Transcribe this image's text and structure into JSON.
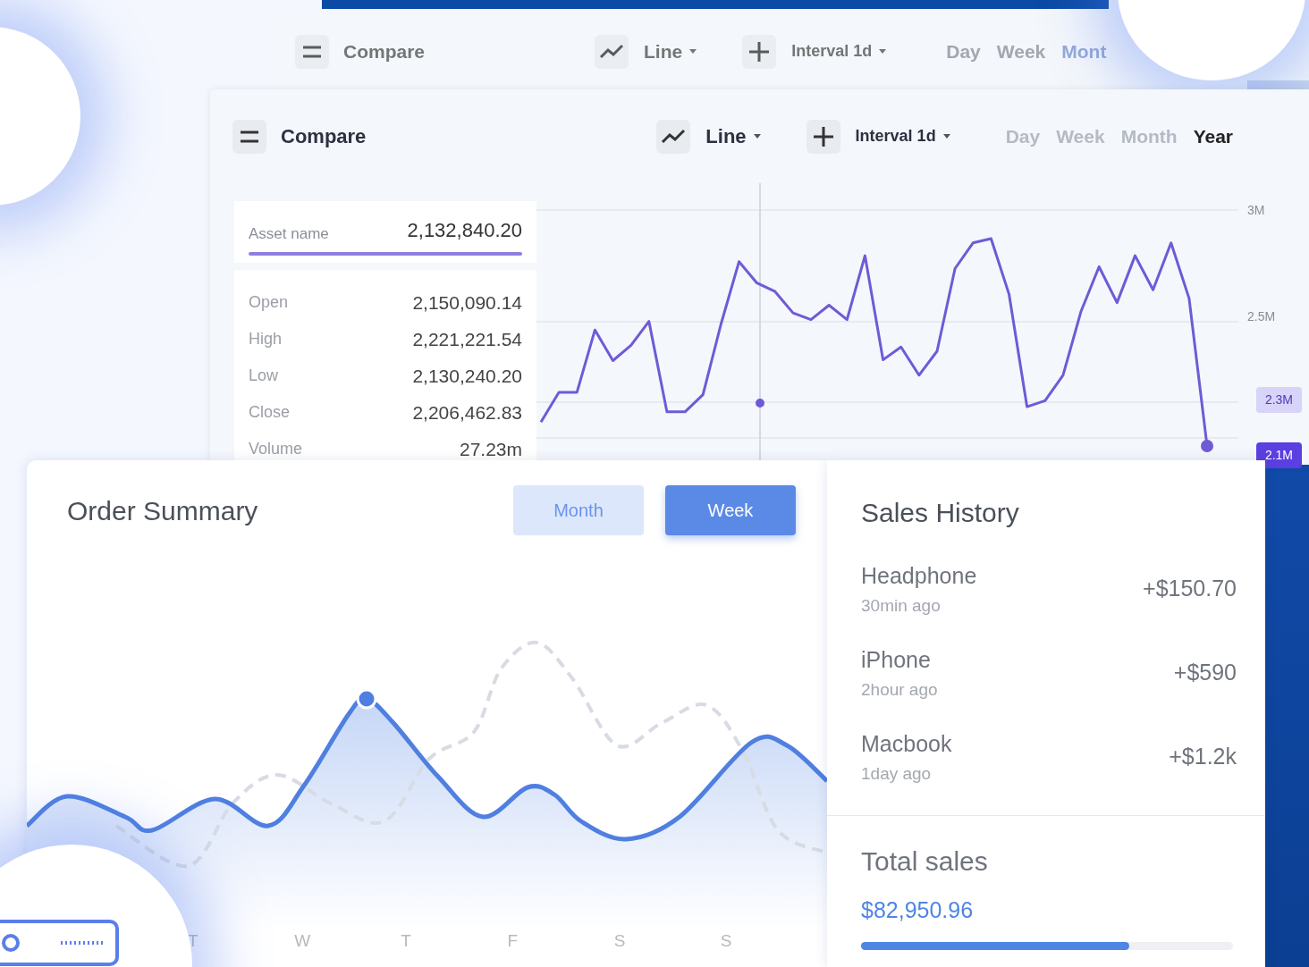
{
  "back_window": {
    "toolbar": {
      "title": "Compare",
      "chart_type": "Line",
      "interval": "Interval 1d",
      "ranges": [
        "Day",
        "Week",
        "Mont"
      ]
    }
  },
  "compare_window": {
    "toolbar": {
      "title": "Compare",
      "chart_type": "Line",
      "interval": "Interval 1d",
      "ranges": [
        {
          "label": "Day",
          "selected": false
        },
        {
          "label": "Week",
          "selected": false
        },
        {
          "label": "Month",
          "selected": false
        },
        {
          "label": "Year",
          "selected": true
        }
      ]
    },
    "asset": {
      "label": "Asset name",
      "value": "2,132,840.20"
    },
    "stats": [
      {
        "label": "Open",
        "value": "2,150,090.14"
      },
      {
        "label": "High",
        "value": "2,221,221.54"
      },
      {
        "label": "Low",
        "value": "2,130,240.20"
      },
      {
        "label": "Close",
        "value": "2,206,462.83"
      },
      {
        "label": "Volume",
        "value": "27.23m"
      }
    ],
    "chart_data": {
      "type": "line",
      "categories": [
        null,
        null,
        null,
        null,
        null,
        null,
        null,
        null,
        null,
        null,
        null,
        null,
        null,
        null,
        null,
        null,
        null,
        null,
        null,
        null,
        null,
        null,
        null,
        null,
        null,
        null,
        null,
        null,
        null,
        null,
        null,
        null,
        null,
        null,
        null,
        null,
        null,
        null
      ],
      "ylim": [
        1.8,
        3.12
      ],
      "yticks": [
        {
          "value": 3,
          "label": "3M"
        },
        {
          "value": 2.5,
          "label": "2.5M"
        }
      ],
      "series": [
        {
          "color": "#6f5ad6",
          "values": [
            2.0,
            2.14,
            2.14,
            2.432,
            2.288,
            2.36,
            2.472,
            2.048,
            2.048,
            2.128,
            2.46,
            2.752,
            2.652,
            2.612,
            2.512,
            2.48,
            2.548,
            2.48,
            2.78,
            2.292,
            2.352,
            2.22,
            2.332,
            2.72,
            2.84,
            2.86,
            2.6,
            2.072,
            2.1,
            2.22,
            2.52,
            2.728,
            2.56,
            2.78,
            2.62,
            2.84,
            2.58,
            1.888
          ]
        }
      ]
    },
    "y_axis": [
      {
        "label": "2.3M",
        "kind": "tag-faded"
      },
      {
        "label": "2.1M",
        "kind": "tag"
      }
    ]
  },
  "order_summary": {
    "title": "Order Summary",
    "toggles": [
      {
        "label": "Month",
        "selected": false
      },
      {
        "label": "Week",
        "selected": true
      }
    ],
    "days": [
      "T",
      "W",
      "T",
      "F",
      "S",
      "S"
    ]
  },
  "sales_history": {
    "title": "Sales History",
    "items": [
      {
        "name": "Headphone",
        "time": "30min ago",
        "amount": "+$150.70"
      },
      {
        "name": "iPhone",
        "time": "2hour ago",
        "amount": "+$590"
      },
      {
        "name": "Macbook",
        "time": "1day ago",
        "amount": "+$1.2k"
      }
    ],
    "total": {
      "title": "Total sales",
      "value": "$82,950.96",
      "level": 0.72
    }
  }
}
